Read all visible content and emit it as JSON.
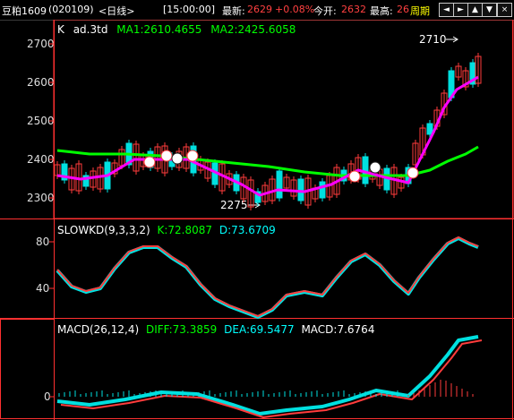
{
  "topbar": {
    "title": "豆粕1609",
    "code": "(020109)",
    "period": "<日线>",
    "time": "[15:00:00]",
    "latest_label": "最新:",
    "latest_value": "2629",
    "change": "+0.08%",
    "open_label": "今开:",
    "open_value": "2632",
    "high_label": "最高:",
    "high_value": "26",
    "cycle_label": "周期",
    "buttons": [
      "◄",
      "►",
      "▲",
      "▼",
      "×"
    ]
  },
  "colors": {
    "up": "#ff3c3c",
    "down": "#00e0e0",
    "ma1": "#ff00ff",
    "ma2": "#00ff00",
    "axis": "#ff3030",
    "yellow": "#ffff00",
    "green": "#00ff00",
    "white": "#ffffff"
  },
  "price_panel": {
    "prefix": "K",
    "name": "ad.3td",
    "ma1_label": "MA1:2610.4655",
    "ma2_label": "MA2:2425.6058",
    "yticks": [
      "2700",
      "2600",
      "2500",
      "2400",
      "2300"
    ],
    "high_note": "2710",
    "low_note": "2275",
    "icons": [
      "smile-icon",
      "smile-icon",
      "smile-icon",
      "neutral-face-icon",
      "neutral-face-icon",
      "smile-icon",
      "neutral-face-icon",
      "smile-icon"
    ]
  },
  "kd_panel": {
    "name": "SLOWKD(9,3,3,2)",
    "k_label": "K:72.8087",
    "d_label": "D:73.6709",
    "yticks": [
      "80",
      "40"
    ]
  },
  "macd_panel": {
    "name": "MACD(26,12,4)",
    "diff_label": "DIFF:73.3859",
    "dea_label": "DEA:69.5477",
    "macd_label": "MACD:7.6764",
    "yticks": [
      "0"
    ]
  }
}
